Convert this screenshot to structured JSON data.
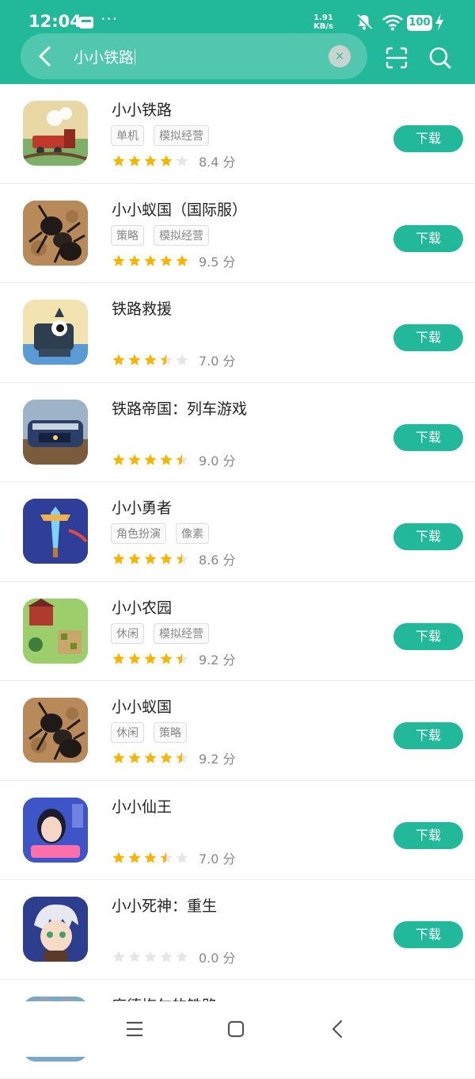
{
  "status_bar": {
    "time": "12:04",
    "dots": "···",
    "speed_value": "1.91",
    "speed_unit": "KB/s",
    "battery": "100"
  },
  "search": {
    "query": "小小铁路",
    "clear_symbol": "×"
  },
  "download_label": "下载",
  "score_unit": "分",
  "apps": [
    {
      "name": "小小铁路",
      "tags": [
        "单机",
        "模拟经营"
      ],
      "rating": 8.4,
      "score": "8.4",
      "stars": [
        1,
        1,
        1,
        1,
        0
      ]
    },
    {
      "name": "小小蚁国（国际服）",
      "tags": [
        "策略",
        "模拟经营"
      ],
      "rating": 9.5,
      "score": "9.5",
      "stars": [
        1,
        1,
        1,
        1,
        1
      ]
    },
    {
      "name": "铁路救援",
      "tags": [],
      "rating": 7.0,
      "score": "7.0",
      "stars": [
        1,
        1,
        1,
        0.5,
        0
      ]
    },
    {
      "name": "铁路帝国：列车游戏",
      "tags": [],
      "rating": 9.0,
      "score": "9.0",
      "stars": [
        1,
        1,
        1,
        1,
        0.5
      ]
    },
    {
      "name": "小小勇者",
      "tags": [
        "角色扮演",
        "像素"
      ],
      "rating": 8.6,
      "score": "8.6",
      "stars": [
        1,
        1,
        1,
        1,
        0.5
      ]
    },
    {
      "name": "小小农园",
      "tags": [
        "休闲",
        "模拟经营"
      ],
      "rating": 9.2,
      "score": "9.2",
      "stars": [
        1,
        1,
        1,
        1,
        0.5
      ]
    },
    {
      "name": "小小蚁国",
      "tags": [
        "休闲",
        "策略"
      ],
      "rating": 9.2,
      "score": "9.2",
      "stars": [
        1,
        1,
        1,
        1,
        0.5
      ]
    },
    {
      "name": "小小仙王",
      "tags": [],
      "rating": 7.0,
      "score": "7.0",
      "stars": [
        1,
        1,
        1,
        0.5,
        0
      ]
    },
    {
      "name": "小小死神：重生",
      "tags": [],
      "rating": 0.0,
      "score": "0.0",
      "stars": [
        0,
        0,
        0,
        0,
        0
      ]
    },
    {
      "name": "席德梅尔的铁路",
      "tags": [],
      "rating": null,
      "score": "",
      "stars": []
    }
  ],
  "icon_art": [
    {
      "name": "train-icon",
      "bg": "#e9d8a6"
    },
    {
      "name": "ant-icon",
      "bg": "#b88a5a"
    },
    {
      "name": "robot-train-icon",
      "bg": "#f3e3b0"
    },
    {
      "name": "locomotive-icon",
      "bg": "#9fb3c8"
    },
    {
      "name": "sword-icon",
      "bg": "#2b3a8f"
    },
    {
      "name": "farm-icon",
      "bg": "#9ccf6b"
    },
    {
      "name": "ant-icon",
      "bg": "#b88a5a"
    },
    {
      "name": "portrait-icon",
      "bg": "#3e55c7"
    },
    {
      "name": "anime-character-icon",
      "bg": "#2e3e8e"
    },
    {
      "name": "koala-icon",
      "bg": "#7aa8c8"
    }
  ],
  "colors": {
    "accent": "#22b89a",
    "star": "#f7b500",
    "star_empty": "#e6e6e6"
  }
}
